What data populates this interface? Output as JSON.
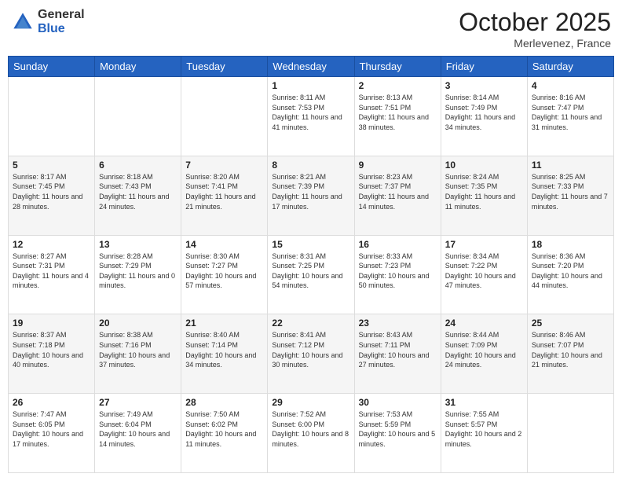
{
  "header": {
    "logo_general": "General",
    "logo_blue": "Blue",
    "month_title": "October 2025",
    "location": "Merlevenez, France"
  },
  "days": [
    "Sunday",
    "Monday",
    "Tuesday",
    "Wednesday",
    "Thursday",
    "Friday",
    "Saturday"
  ],
  "weeks": [
    [
      {
        "date": "",
        "sunrise": "",
        "sunset": "",
        "daylight": ""
      },
      {
        "date": "",
        "sunrise": "",
        "sunset": "",
        "daylight": ""
      },
      {
        "date": "",
        "sunrise": "",
        "sunset": "",
        "daylight": ""
      },
      {
        "date": "1",
        "sunrise": "Sunrise: 8:11 AM",
        "sunset": "Sunset: 7:53 PM",
        "daylight": "Daylight: 11 hours and 41 minutes."
      },
      {
        "date": "2",
        "sunrise": "Sunrise: 8:13 AM",
        "sunset": "Sunset: 7:51 PM",
        "daylight": "Daylight: 11 hours and 38 minutes."
      },
      {
        "date": "3",
        "sunrise": "Sunrise: 8:14 AM",
        "sunset": "Sunset: 7:49 PM",
        "daylight": "Daylight: 11 hours and 34 minutes."
      },
      {
        "date": "4",
        "sunrise": "Sunrise: 8:16 AM",
        "sunset": "Sunset: 7:47 PM",
        "daylight": "Daylight: 11 hours and 31 minutes."
      }
    ],
    [
      {
        "date": "5",
        "sunrise": "Sunrise: 8:17 AM",
        "sunset": "Sunset: 7:45 PM",
        "daylight": "Daylight: 11 hours and 28 minutes."
      },
      {
        "date": "6",
        "sunrise": "Sunrise: 8:18 AM",
        "sunset": "Sunset: 7:43 PM",
        "daylight": "Daylight: 11 hours and 24 minutes."
      },
      {
        "date": "7",
        "sunrise": "Sunrise: 8:20 AM",
        "sunset": "Sunset: 7:41 PM",
        "daylight": "Daylight: 11 hours and 21 minutes."
      },
      {
        "date": "8",
        "sunrise": "Sunrise: 8:21 AM",
        "sunset": "Sunset: 7:39 PM",
        "daylight": "Daylight: 11 hours and 17 minutes."
      },
      {
        "date": "9",
        "sunrise": "Sunrise: 8:23 AM",
        "sunset": "Sunset: 7:37 PM",
        "daylight": "Daylight: 11 hours and 14 minutes."
      },
      {
        "date": "10",
        "sunrise": "Sunrise: 8:24 AM",
        "sunset": "Sunset: 7:35 PM",
        "daylight": "Daylight: 11 hours and 11 minutes."
      },
      {
        "date": "11",
        "sunrise": "Sunrise: 8:25 AM",
        "sunset": "Sunset: 7:33 PM",
        "daylight": "Daylight: 11 hours and 7 minutes."
      }
    ],
    [
      {
        "date": "12",
        "sunrise": "Sunrise: 8:27 AM",
        "sunset": "Sunset: 7:31 PM",
        "daylight": "Daylight: 11 hours and 4 minutes."
      },
      {
        "date": "13",
        "sunrise": "Sunrise: 8:28 AM",
        "sunset": "Sunset: 7:29 PM",
        "daylight": "Daylight: 11 hours and 0 minutes."
      },
      {
        "date": "14",
        "sunrise": "Sunrise: 8:30 AM",
        "sunset": "Sunset: 7:27 PM",
        "daylight": "Daylight: 10 hours and 57 minutes."
      },
      {
        "date": "15",
        "sunrise": "Sunrise: 8:31 AM",
        "sunset": "Sunset: 7:25 PM",
        "daylight": "Daylight: 10 hours and 54 minutes."
      },
      {
        "date": "16",
        "sunrise": "Sunrise: 8:33 AM",
        "sunset": "Sunset: 7:23 PM",
        "daylight": "Daylight: 10 hours and 50 minutes."
      },
      {
        "date": "17",
        "sunrise": "Sunrise: 8:34 AM",
        "sunset": "Sunset: 7:22 PM",
        "daylight": "Daylight: 10 hours and 47 minutes."
      },
      {
        "date": "18",
        "sunrise": "Sunrise: 8:36 AM",
        "sunset": "Sunset: 7:20 PM",
        "daylight": "Daylight: 10 hours and 44 minutes."
      }
    ],
    [
      {
        "date": "19",
        "sunrise": "Sunrise: 8:37 AM",
        "sunset": "Sunset: 7:18 PM",
        "daylight": "Daylight: 10 hours and 40 minutes."
      },
      {
        "date": "20",
        "sunrise": "Sunrise: 8:38 AM",
        "sunset": "Sunset: 7:16 PM",
        "daylight": "Daylight: 10 hours and 37 minutes."
      },
      {
        "date": "21",
        "sunrise": "Sunrise: 8:40 AM",
        "sunset": "Sunset: 7:14 PM",
        "daylight": "Daylight: 10 hours and 34 minutes."
      },
      {
        "date": "22",
        "sunrise": "Sunrise: 8:41 AM",
        "sunset": "Sunset: 7:12 PM",
        "daylight": "Daylight: 10 hours and 30 minutes."
      },
      {
        "date": "23",
        "sunrise": "Sunrise: 8:43 AM",
        "sunset": "Sunset: 7:11 PM",
        "daylight": "Daylight: 10 hours and 27 minutes."
      },
      {
        "date": "24",
        "sunrise": "Sunrise: 8:44 AM",
        "sunset": "Sunset: 7:09 PM",
        "daylight": "Daylight: 10 hours and 24 minutes."
      },
      {
        "date": "25",
        "sunrise": "Sunrise: 8:46 AM",
        "sunset": "Sunset: 7:07 PM",
        "daylight": "Daylight: 10 hours and 21 minutes."
      }
    ],
    [
      {
        "date": "26",
        "sunrise": "Sunrise: 7:47 AM",
        "sunset": "Sunset: 6:05 PM",
        "daylight": "Daylight: 10 hours and 17 minutes."
      },
      {
        "date": "27",
        "sunrise": "Sunrise: 7:49 AM",
        "sunset": "Sunset: 6:04 PM",
        "daylight": "Daylight: 10 hours and 14 minutes."
      },
      {
        "date": "28",
        "sunrise": "Sunrise: 7:50 AM",
        "sunset": "Sunset: 6:02 PM",
        "daylight": "Daylight: 10 hours and 11 minutes."
      },
      {
        "date": "29",
        "sunrise": "Sunrise: 7:52 AM",
        "sunset": "Sunset: 6:00 PM",
        "daylight": "Daylight: 10 hours and 8 minutes."
      },
      {
        "date": "30",
        "sunrise": "Sunrise: 7:53 AM",
        "sunset": "Sunset: 5:59 PM",
        "daylight": "Daylight: 10 hours and 5 minutes."
      },
      {
        "date": "31",
        "sunrise": "Sunrise: 7:55 AM",
        "sunset": "Sunset: 5:57 PM",
        "daylight": "Daylight: 10 hours and 2 minutes."
      },
      {
        "date": "",
        "sunrise": "",
        "sunset": "",
        "daylight": ""
      }
    ]
  ]
}
